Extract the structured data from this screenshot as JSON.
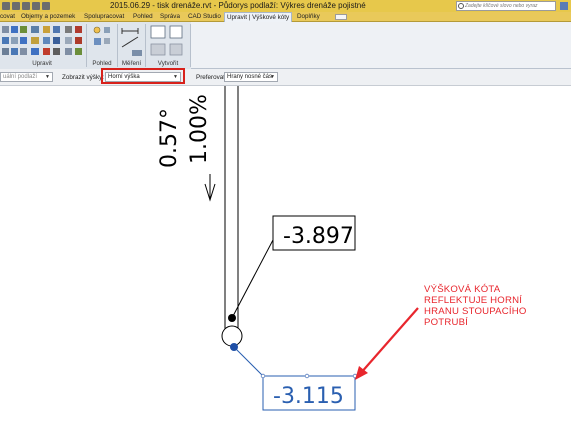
{
  "window": {
    "title": "2015.06.29 - tisk drenáže.rvt - Půdorys podlaží: Výkres drenáže pojistné",
    "help_search_placeholder": "Zadejte klíčové slovo nebo vyraz"
  },
  "tabs": [
    {
      "label": "covat",
      "active": false
    },
    {
      "label": "Objemy a pozemek",
      "active": false
    },
    {
      "label": "Spolupracovat",
      "active": false
    },
    {
      "label": "Pohled",
      "active": false
    },
    {
      "label": "Správa",
      "active": false
    },
    {
      "label": "CAD Studio",
      "active": false
    },
    {
      "label": "Upravit | Výškové kóty",
      "active": true
    },
    {
      "label": "Doplňky",
      "active": false
    }
  ],
  "ribbon": {
    "panels": [
      {
        "label": "Upravit"
      },
      {
        "label": "Pohled"
      },
      {
        "label": "Měření"
      },
      {
        "label": "Vytvořit"
      }
    ]
  },
  "options_bar": {
    "level_value": "uální podlaží",
    "display_label": "Zobrazit výšky:",
    "display_value": "Horní výška",
    "prefer_label": "Preferovat:",
    "prefer_value": "Hrany nosné čás"
  },
  "drawing": {
    "slope_angle": "0.57°",
    "slope_percent": "1.00%",
    "elevation_top": "-3.897",
    "elevation_bottom": "-3.115"
  },
  "annotation": {
    "lines": [
      "VÝŠKOVÁ KÓTA",
      "REFLEKTUJE HORNÍ",
      "HRANU STOUPACÍHO",
      "POTRUBÍ"
    ],
    "color": "#e8262d"
  },
  "colors": {
    "title_bar": "#e7c84b",
    "highlight": "#d8211b",
    "selected_tag": "#2a5fb0"
  }
}
